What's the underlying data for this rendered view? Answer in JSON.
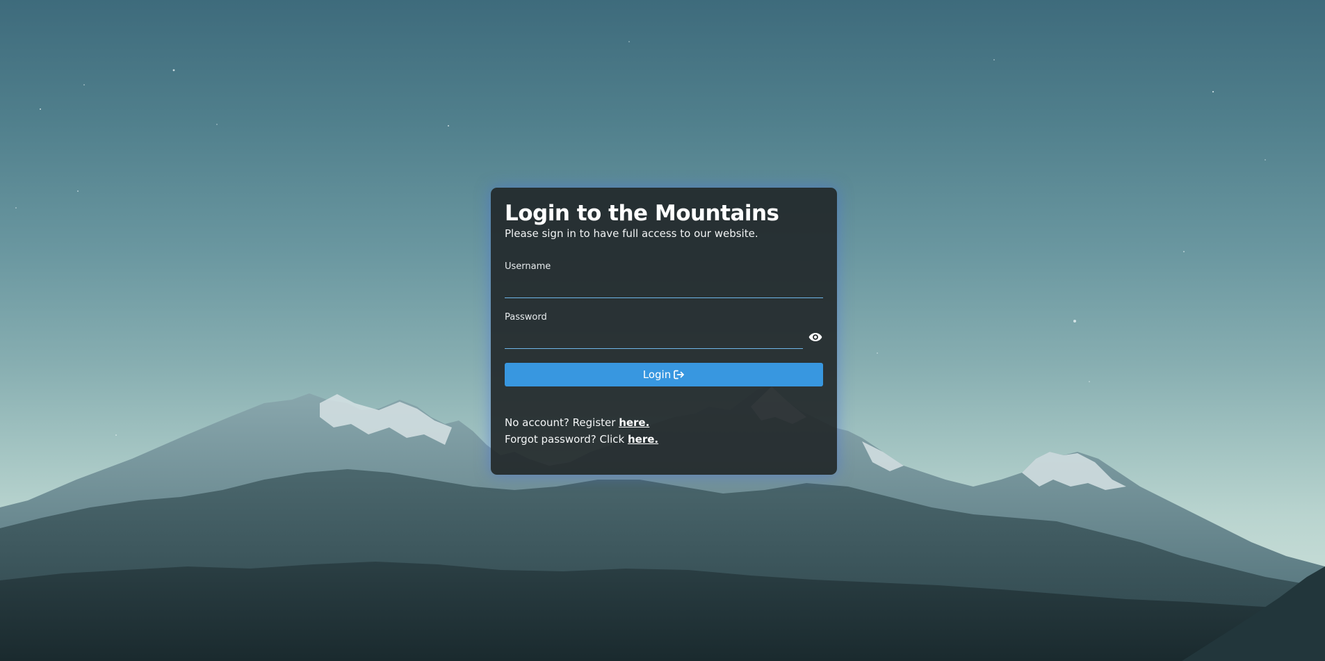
{
  "login": {
    "title": "Login to the Mountains",
    "subtitle": "Please sign in to have full access to our website.",
    "username": {
      "label": "Username",
      "value": "",
      "placeholder": ""
    },
    "password": {
      "label": "Password",
      "value": "",
      "placeholder": "",
      "toggle_icon": "eye-icon"
    },
    "button": {
      "label": "Login",
      "icon": "sign-in-icon",
      "color": "#3897e0"
    },
    "register": {
      "prefix": "No account? Register ",
      "link": "here."
    },
    "forgot": {
      "prefix": "Forgot password? Click ",
      "link": "here."
    }
  },
  "theme": {
    "card_background": "#202628",
    "input_underline": "#6fb6e8",
    "card_glow": "#4670dc"
  }
}
